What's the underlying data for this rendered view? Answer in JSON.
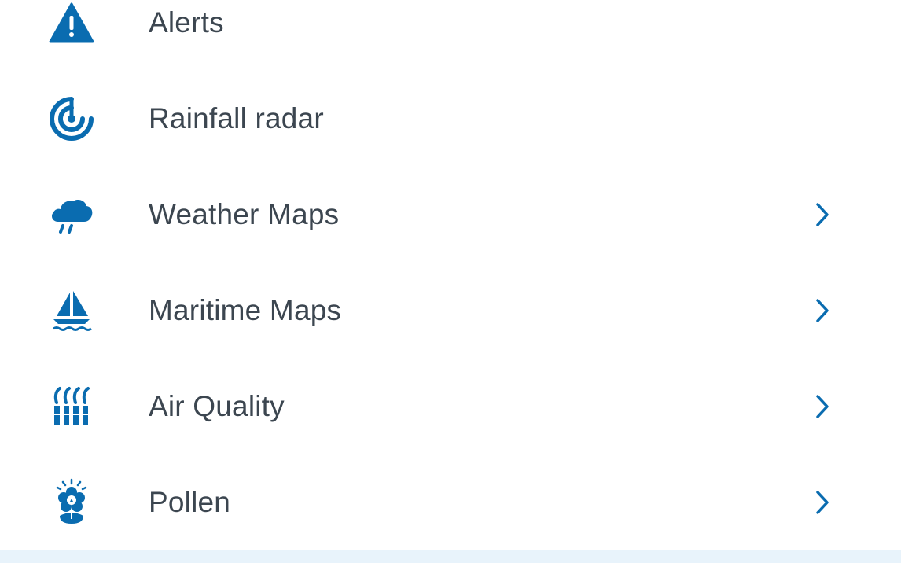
{
  "colors": {
    "accent": "#0a6cb0",
    "text": "#3c4650",
    "band": "#e8f3fb"
  },
  "menu": {
    "items": [
      {
        "label": "Alerts",
        "icon": "warning-triangle-icon",
        "has_chevron": false
      },
      {
        "label": "Rainfall radar",
        "icon": "radar-icon",
        "has_chevron": false
      },
      {
        "label": "Weather Maps",
        "icon": "rain-cloud-icon",
        "has_chevron": true
      },
      {
        "label": "Maritime Maps",
        "icon": "sailboat-icon",
        "has_chevron": true
      },
      {
        "label": "Air Quality",
        "icon": "air-quality-icon",
        "has_chevron": true
      },
      {
        "label": "Pollen",
        "icon": "pollen-flower-icon",
        "has_chevron": true
      }
    ]
  }
}
